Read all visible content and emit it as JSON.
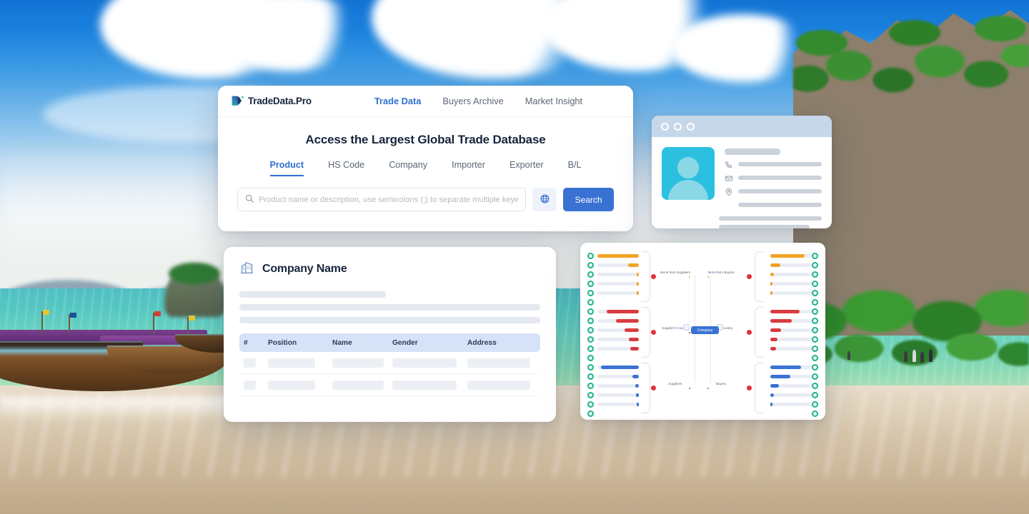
{
  "background": {
    "scene": "tropical-beach-photo",
    "description": "Railay-style beach with blue sky, clouds, limestone cliff, longtail boats and turquoise sea",
    "sky_color": "#1b81dd",
    "sea_color": "#56c8c2",
    "sand_color": "#d9c8ae",
    "cliff_color": "#8d7f6b",
    "foliage_color": "#3c9537"
  },
  "colors": {
    "accent_blue": "#3a72d4",
    "active_nav": "#2f6fd0",
    "title_navy": "#18253d",
    "muted_text": "#5b6675",
    "placeholder": "#b3bac5",
    "table_header_bg": "#d6e2f7",
    "skeleton": "#e4e8ef",
    "avatar_bg": "#2cc0e0",
    "chrome_bg": "#c7d7ea",
    "node_green": "#18b487",
    "node_red": "#e0333a",
    "bar_orange": "#f0a427",
    "bar_red": "#d93b40",
    "bar_blue": "#3a72d4"
  },
  "search_panel": {
    "logo": {
      "icon": "tradedata-logo-icon",
      "text": "TradeData.Pro"
    },
    "top_nav": [
      {
        "label": "Trade Data",
        "active": true
      },
      {
        "label": "Buyers Archive",
        "active": false
      },
      {
        "label": "Market Insight",
        "active": false
      }
    ],
    "title": "Access the Largest Global Trade Database",
    "tabs": [
      {
        "label": "Product",
        "active": true
      },
      {
        "label": "HS Code",
        "active": false
      },
      {
        "label": "Company",
        "active": false
      },
      {
        "label": "Importer",
        "active": false
      },
      {
        "label": "Exporter",
        "active": false
      },
      {
        "label": "B/L",
        "active": false
      }
    ],
    "search": {
      "icon": "search-icon",
      "value": "",
      "placeholder": "Product name or description, use semicolons (;) to separate multiple keywords"
    },
    "globe_button": {
      "icon": "globe-icon",
      "label": ""
    },
    "search_button": {
      "label": "Search"
    }
  },
  "profile_card": {
    "window_dots": [
      "dot-1",
      "dot-2",
      "dot-3"
    ],
    "avatar": {
      "icon": "user-avatar-icon"
    },
    "name_placeholder": "",
    "rows": [
      {
        "icon": "phone-icon",
        "value": ""
      },
      {
        "icon": "email-icon",
        "value": ""
      },
      {
        "icon": "location-icon",
        "value": ""
      }
    ]
  },
  "company_card": {
    "icon": "company-building-icon",
    "title": "Company Name",
    "skeleton_lines": 3,
    "table": {
      "columns": [
        "#",
        "Position",
        "Name",
        "Gender",
        "Address"
      ],
      "rows": [
        {
          "num": "",
          "position": "",
          "name": "",
          "gender": "",
          "address": ""
        },
        {
          "num": "",
          "position": "",
          "name": "",
          "gender": "",
          "address": ""
        }
      ]
    }
  },
  "network_card": {
    "center_node": "Company",
    "left_groups": [
      {
        "label": "Items from Suppliers",
        "color": "#f0a427",
        "bars": [
          100,
          26,
          6,
          5,
          4
        ]
      },
      {
        "label": "Supplier's Country",
        "color": "#d93b40",
        "bars": [
          78,
          55,
          34,
          24,
          20
        ]
      },
      {
        "label": "Suppliers",
        "color": "#3a72d4",
        "bars": [
          92,
          16,
          9,
          7,
          6
        ]
      }
    ],
    "right_groups": [
      {
        "label": "Items from Buyers",
        "color": "#f0a427",
        "bars": [
          82,
          24,
          8,
          6,
          5
        ]
      },
      {
        "label": "Buyer's Country",
        "color": "#d93b40",
        "bars": [
          70,
          52,
          26,
          18,
          14
        ]
      },
      {
        "label": "Buyers",
        "color": "#3a72d4",
        "bars": [
          74,
          48,
          20,
          8,
          6
        ]
      }
    ]
  }
}
